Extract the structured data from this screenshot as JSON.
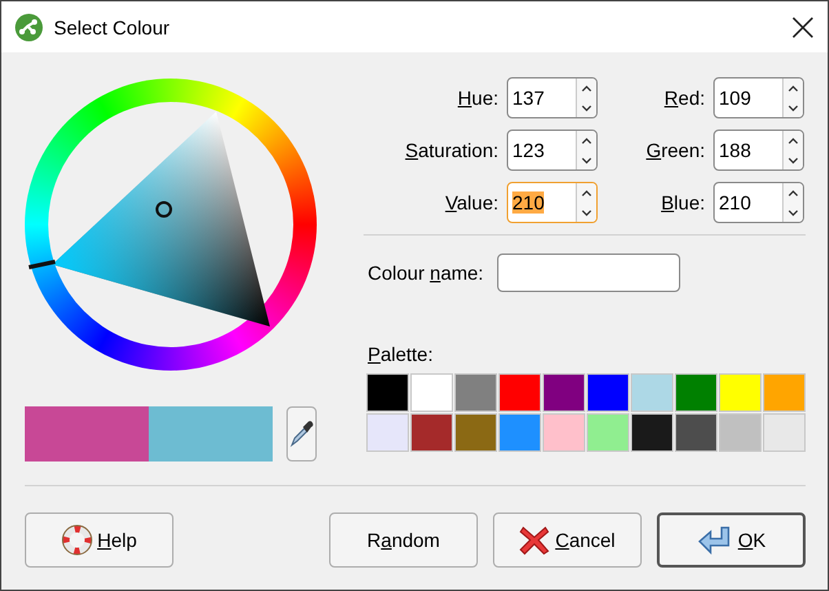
{
  "window": {
    "title": "Select Colour"
  },
  "hsv_fields": [
    {
      "label": {
        "key": "H",
        "after": "ue:"
      },
      "value": "137",
      "focused": false
    },
    {
      "label": {
        "key": "S",
        "after": "aturation:"
      },
      "value": "123",
      "focused": false
    },
    {
      "label": {
        "key": "V",
        "after": "alue:"
      },
      "value": "210",
      "focused": true
    }
  ],
  "rgb_fields": [
    {
      "label": {
        "key": "R",
        "after": "ed:"
      },
      "value": "109",
      "focused": false
    },
    {
      "label": {
        "key": "G",
        "after": "reen:"
      },
      "value": "188",
      "focused": false
    },
    {
      "label": {
        "key": "B",
        "after": "lue:"
      },
      "value": "210",
      "focused": false
    }
  ],
  "colour_name": {
    "label": {
      "before": "Colour ",
      "key": "n",
      "after": "ame:"
    }
  },
  "palette": {
    "label": {
      "key": "P",
      "after": "alette:"
    },
    "swatches": [
      {
        "color": "#000000"
      },
      {
        "color": "#ffffff"
      },
      {
        "color": "#808080"
      },
      {
        "color": "#ff0000"
      },
      {
        "color": "#800080"
      },
      {
        "color": "#0000ff"
      },
      {
        "color": "#add8e6"
      },
      {
        "color": "#008000"
      },
      {
        "color": "#ffff00"
      },
      {
        "color": "#ffa500"
      },
      {
        "color": "#e6e6fa"
      },
      {
        "color": "#a52a2a"
      },
      {
        "color": "#8b6914"
      },
      {
        "color": "#1e90ff"
      },
      {
        "color": "#ffc0cb"
      },
      {
        "color": "#90ee90"
      },
      {
        "color": "#1a1a1a"
      },
      {
        "color": "#4d4d4d"
      },
      {
        "color": "#c0c0c0"
      },
      {
        "color": "#e8e8e8"
      }
    ]
  },
  "preview": [
    {
      "color": "#c84896"
    },
    {
      "color": "#6dbcd2"
    }
  ],
  "buttons": [
    {
      "kind": "help",
      "label": {
        "key": "H",
        "after": "elp"
      },
      "default": false
    },
    {
      "kind": "random",
      "label": {
        "before": "R",
        "key": "a",
        "after": "ndom"
      },
      "default": false
    },
    {
      "kind": "cancel",
      "label": {
        "key": "C",
        "after": "ancel"
      },
      "default": false
    },
    {
      "kind": "ok",
      "label": {
        "key": "O",
        "after": "K"
      },
      "default": true
    }
  ]
}
